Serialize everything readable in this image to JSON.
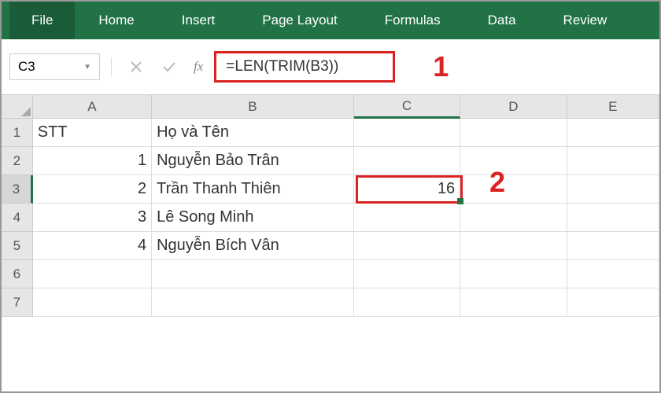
{
  "ribbon": {
    "tabs": [
      "File",
      "Home",
      "Insert",
      "Page Layout",
      "Formulas",
      "Data",
      "Review"
    ]
  },
  "nameBox": {
    "value": "C3"
  },
  "fxLabel": "fx",
  "formulaBar": {
    "value": "=LEN(TRIM(B3))"
  },
  "columns": [
    "A",
    "B",
    "C",
    "D",
    "E"
  ],
  "rows": [
    "1",
    "2",
    "3",
    "4",
    "5",
    "6",
    "7"
  ],
  "cells": {
    "A1": "STT",
    "B1": "Họ và Tên",
    "A2": "1",
    "B2": "Nguyễn Bảo Trân",
    "A3": "2",
    "B3": "Trần Thanh Thiên",
    "C3": "16",
    "A4": "3",
    "B4": "Lê Song Minh",
    "A5": "4",
    "B5": "Nguyễn Bích Vân"
  },
  "annotations": {
    "a1": "1",
    "a2": "2"
  }
}
